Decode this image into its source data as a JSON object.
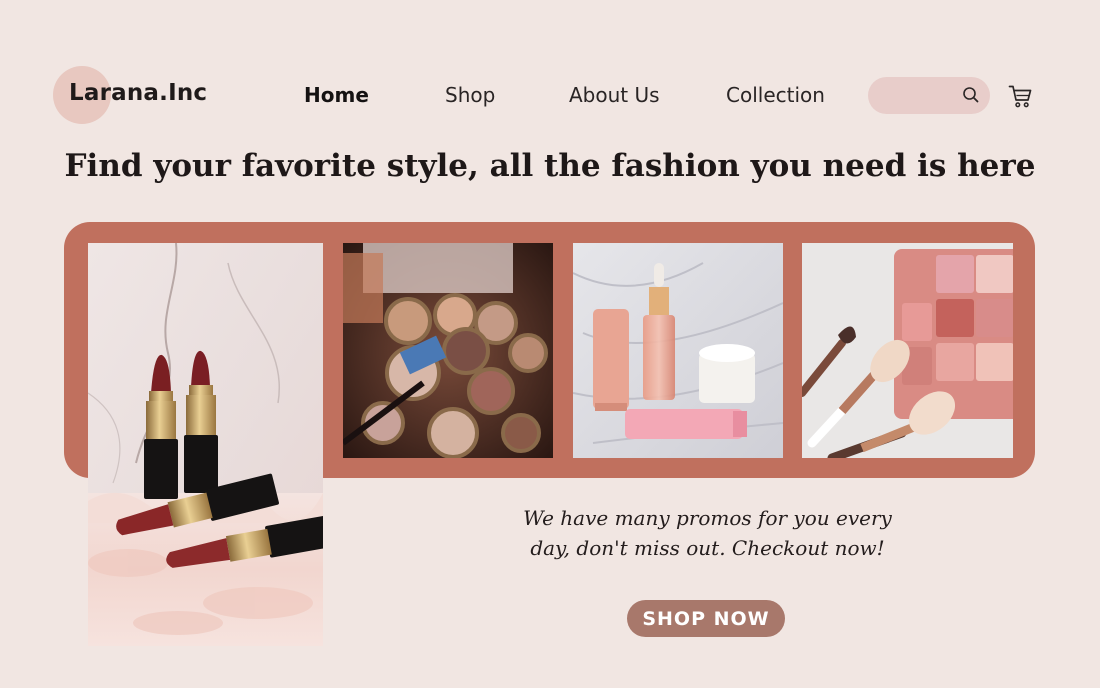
{
  "brand": {
    "name": "Larana.Inc"
  },
  "nav": {
    "items": [
      {
        "label": "Home",
        "active": true
      },
      {
        "label": "Shop",
        "active": false
      },
      {
        "label": "About Us",
        "active": false
      },
      {
        "label": "Collection",
        "active": false
      }
    ]
  },
  "search": {
    "value": "",
    "placeholder": ""
  },
  "hero": {
    "headline": "Find your favorite style, all the fashion you need is here",
    "promo_line1": "We have many promos for you every",
    "promo_line2": "day, don't miss out. Checkout now!",
    "cta_label": "SHOP NOW"
  },
  "icons": {
    "search": "search-icon",
    "cart": "cart-icon"
  },
  "colors": {
    "background": "#f1e6e2",
    "band": "#c0705e",
    "search_bg": "#e8cdca",
    "button": "#a8786b",
    "logo_circle": "#e8c8c0"
  }
}
